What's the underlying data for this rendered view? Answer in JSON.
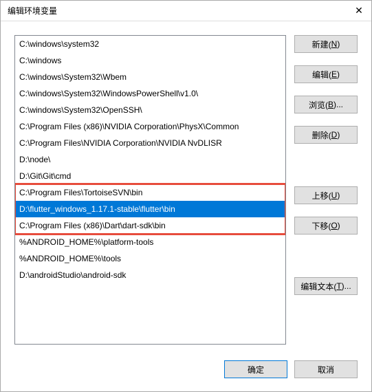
{
  "window": {
    "title": "编辑环境变量",
    "close_label": "✕"
  },
  "list": {
    "items": [
      "C:\\windows\\system32",
      "C:\\windows",
      "C:\\windows\\System32\\Wbem",
      "C:\\windows\\System32\\WindowsPowerShell\\v1.0\\",
      "C:\\windows\\System32\\OpenSSH\\",
      "C:\\Program Files (x86)\\NVIDIA Corporation\\PhysX\\Common",
      "C:\\Program Files\\NVIDIA Corporation\\NVIDIA NvDLISR",
      "D:\\node\\",
      "D:\\Git\\Git\\cmd",
      "C:\\Program Files\\TortoiseSVN\\bin",
      "D:\\flutter_windows_1.17.1-stable\\flutter\\bin",
      "C:\\Program Files (x86)\\Dart\\dart-sdk\\bin",
      "%ANDROID_HOME%\\platform-tools",
      "%ANDROID_HOME%\\tools",
      "D:\\androidStudio\\android-sdk"
    ],
    "selected_index": 10,
    "highlight_range": [
      9,
      11
    ]
  },
  "buttons": {
    "new": {
      "label": "新建(",
      "accel": "N",
      "suffix": ")"
    },
    "edit": {
      "label": "编辑(",
      "accel": "E",
      "suffix": ")"
    },
    "browse": {
      "label": "浏览(",
      "accel": "B",
      "suffix": ")..."
    },
    "delete": {
      "label": "删除(",
      "accel": "D",
      "suffix": ")"
    },
    "move_up": {
      "label": "上移(",
      "accel": "U",
      "suffix": ")"
    },
    "move_down": {
      "label": "下移(",
      "accel": "O",
      "suffix": ")"
    },
    "edit_text": {
      "label": "编辑文本(",
      "accel": "T",
      "suffix": ")..."
    }
  },
  "footer": {
    "ok": "确定",
    "cancel": "取消"
  }
}
